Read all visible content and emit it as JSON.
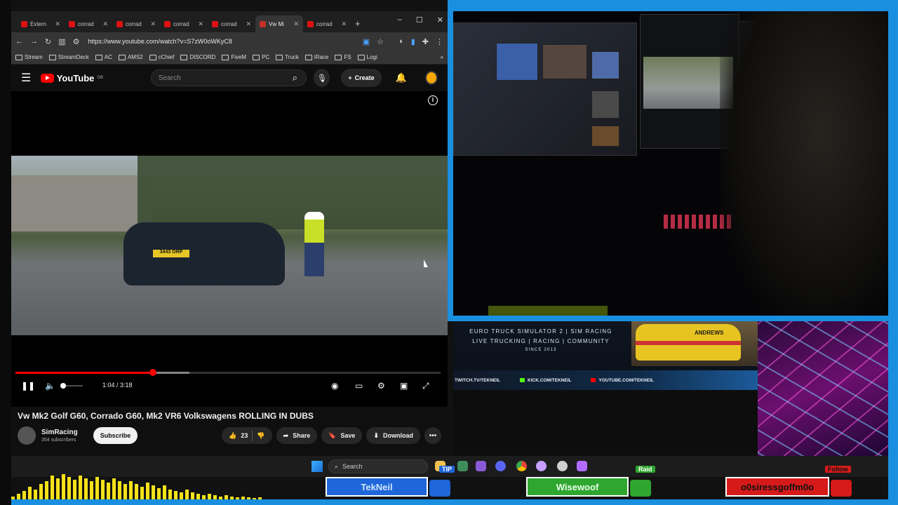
{
  "browser": {
    "tabs": [
      {
        "label": "Extern",
        "active": false
      },
      {
        "label": "corrad",
        "active": false
      },
      {
        "label": "corrad",
        "active": false
      },
      {
        "label": "corrad",
        "active": false
      },
      {
        "label": "corrad",
        "active": false
      },
      {
        "label": "Vw Mi",
        "active": true
      },
      {
        "label": "corrad",
        "active": false
      }
    ],
    "url": "https://www.youtube.com/watch?v=S7zW0oWKyC8",
    "bookmarks": [
      "Stream",
      "StreamDeck",
      "AC",
      "AMS2",
      "cChief",
      "DISCORD",
      "FiveM",
      "PC",
      "Truck",
      "iRace",
      "FS",
      "Logi"
    ]
  },
  "youtube": {
    "logo_text": "YouTube",
    "region": "GB",
    "search_placeholder": "Search",
    "create_label": "Create",
    "video": {
      "plate_text": "3443 ORP",
      "current_time": "1:04",
      "duration": "3:18",
      "time_display": "1:04 / 3:18",
      "progress_fraction": 0.323,
      "buffered_fraction": 0.41
    },
    "title": "Vw Mk2 Golf G60, Corrado G60, Mk2 VR6 Volkswagens ROLLING IN DUBS",
    "channel": {
      "name": "SimRacing",
      "subscribers": "354 subscribers"
    },
    "subscribe_label": "Subscribe",
    "like_count": "23",
    "share_label": "Share",
    "save_label": "Save",
    "download_label": "Download"
  },
  "banner": {
    "line1": "EURO TRUCK SIMULATOR 2 | SIM RACING",
    "line2": "LIVE TRUCKING | RACING | COMMUNITY",
    "line3": "SINCE 2013",
    "social": [
      "TWITCH.TV/TEKNEIL",
      "KICK.COM/TEKNEIL",
      "YOUTUBE.COM/TEKNEIL"
    ],
    "rally_sponsor": "ANDREWS"
  },
  "taskbar": {
    "search_label": "Search"
  },
  "alerts": {
    "tip_tag": "TIP",
    "tip_name": "TekNeil",
    "raid_tag": "Raid",
    "raid_name": "Wisewoof",
    "follow_tag": "Follow",
    "follow_name": "o0siressgoffm0o"
  },
  "colors": {
    "frame": "#1a8fe0",
    "youtube_red": "#ff0000",
    "eq_yellow": "#f7e21a"
  }
}
